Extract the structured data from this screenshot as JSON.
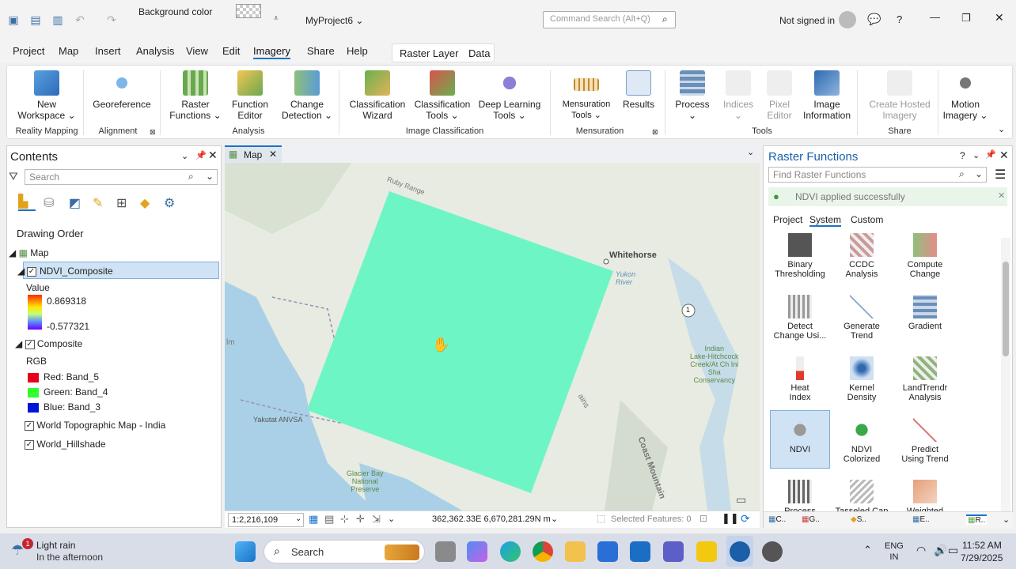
{
  "qat": {
    "background_color_label": "Background color",
    "project_name": "MyProject6",
    "command_search_placeholder": "Command Search (Alt+Q)",
    "sign_in": "Not signed in"
  },
  "menu": {
    "items": [
      "Project",
      "Map",
      "Insert",
      "Analysis",
      "View",
      "Edit",
      "Imagery",
      "Share",
      "Help"
    ],
    "context_tabs": [
      "Raster Layer",
      "Data"
    ],
    "active": "Imagery"
  },
  "ribbon": {
    "buttons": {
      "new_workspace": "New\nWorkspace",
      "georeference": "Georeference",
      "raster_functions": "Raster\nFunctions",
      "function_editor": "Function\nEditor",
      "change_detection": "Change\nDetection",
      "classification_wizard": "Classification\nWizard",
      "classification_tools": "Classification\nTools",
      "deep_learning_tools": "Deep Learning\nTools",
      "mensuration_tools": "Mensuration\nTools",
      "results": "Results",
      "process": "Process",
      "indices": "Indices",
      "pixel_editor": "Pixel\nEditor",
      "image_information": "Image\nInformation",
      "create_hosted_imagery": "Create Hosted\nImagery",
      "motion_imagery": "Motion\nImagery"
    },
    "groups": {
      "reality_mapping": "Reality Mapping",
      "alignment": "Alignment",
      "analysis": "Analysis",
      "image_classification": "Image Classification",
      "mensuration": "Mensuration",
      "tools": "Tools",
      "share": "Share"
    }
  },
  "contents": {
    "title": "Contents",
    "search_placeholder": "Search",
    "drawing_order": "Drawing Order",
    "map_label": "Map",
    "layers": {
      "ndvi": "NDVI_Composite",
      "value_label": "Value",
      "ndvi_max": "0.869318",
      "ndvi_min": "-0.577321",
      "composite": "Composite",
      "rgb_label": "RGB",
      "red": "Red:  Band_5",
      "green": "Green: Band_4",
      "blue": "Blue:  Band_3",
      "topo": "World Topographic Map - India",
      "hillshade": "World_Hillshade"
    },
    "colors": {
      "red": "#e8001b",
      "green": "#31ff2d",
      "blue": "#0014d8"
    }
  },
  "map": {
    "tab": "Map",
    "labels": {
      "whitehorse": "Whitehorse",
      "yukon": "Yukon\nRiver",
      "ruby": "Ruby Range",
      "yakutat": "Yakutat ANVSA",
      "glacier": "Glacier Bay\nNational\nPreserve",
      "indian": "Indian\nLake-Hitchcock\nCreek/At Ch Ini\nSha\nConservancy",
      "coast": "Coast Mountain",
      "hwy": "1",
      "ains": "ains",
      "lm": "lm"
    },
    "scale": "1:2,216,109",
    "coords": "362,362.33E 6,670,281.29N m",
    "selected": "Selected Features: 0",
    "ndvi_color": "#6ef5c6"
  },
  "raster_functions": {
    "title": "Raster Functions",
    "search_placeholder": "Find Raster Functions",
    "notice": "NDVI applied successfully",
    "tabs": [
      "Project",
      "System",
      "Custom"
    ],
    "active_tab": "System",
    "functions": [
      "Binary\nThresholding",
      "CCDC\nAnalysis",
      "Compute\nChange",
      "Detect\nChange Usi...",
      "Generate\nTrend",
      "Gradient",
      "Heat\nIndex",
      "Kernel\nDensity",
      "LandTrendr\nAnalysis",
      "NDVI",
      "NDVI\nColorized",
      "Predict\nUsing Trend",
      "Process",
      "Tasseled Cap",
      "Weighted"
    ],
    "selected": "NDVI",
    "bottom_tabs": [
      "C..",
      "G..",
      "S..",
      "E..",
      "R.."
    ]
  },
  "taskbar": {
    "weather_title": "Light rain",
    "weather_sub": "In the afternoon",
    "weather_badge": "1",
    "search": "Search",
    "lang": "ENG\nIN",
    "time": "11:52 AM",
    "date": "7/29/2025"
  }
}
